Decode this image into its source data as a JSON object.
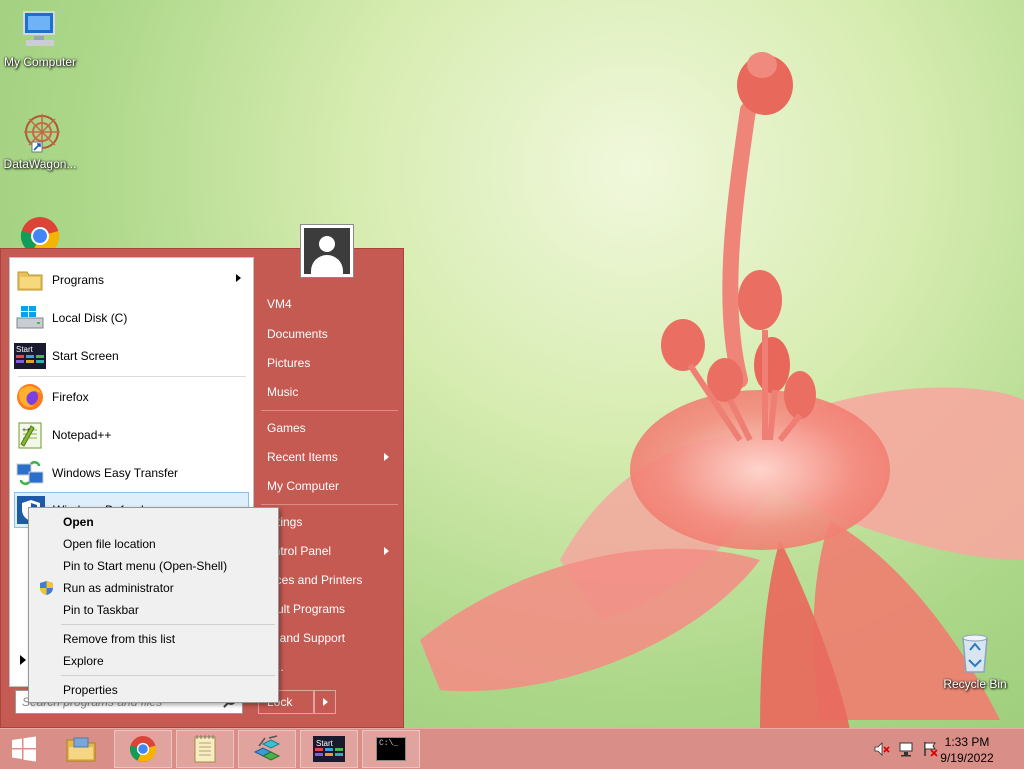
{
  "desktop": {
    "icons": [
      {
        "label": "My Computer",
        "icon": "computer-icon"
      },
      {
        "label": "DataWagon...",
        "icon": "datawagon-icon"
      },
      {
        "label": "",
        "icon": "chrome-icon"
      },
      {
        "label": "Recycle Bin",
        "icon": "recycle-bin-icon"
      }
    ]
  },
  "start_menu": {
    "programs": [
      {
        "label": "Programs",
        "icon": "folder-icon",
        "has_submenu": true
      },
      {
        "label": "Local Disk (C)",
        "icon": "drive-icon"
      },
      {
        "label": "Start Screen",
        "icon": "start-screen-icon"
      },
      {
        "label": "Firefox",
        "icon": "firefox-icon"
      },
      {
        "label": "Notepad++",
        "icon": "notepadpp-icon"
      },
      {
        "label": "Windows Easy Transfer",
        "icon": "easy-transfer-icon"
      },
      {
        "label": "Windows Defender",
        "icon": "defender-icon"
      }
    ],
    "search_placeholder": "Search programs and files",
    "right_items": [
      {
        "label": "VM4"
      },
      {
        "label": "Documents"
      },
      {
        "label": "Pictures"
      },
      {
        "label": "Music"
      },
      {
        "label": "Games"
      },
      {
        "label": "Recent Items",
        "has_submenu": true
      },
      {
        "label": "My Computer"
      },
      {
        "label": "ettings"
      },
      {
        "label": "ontrol Panel",
        "has_submenu": true
      },
      {
        "label": "vices and Printers"
      },
      {
        "label": "fault Programs"
      },
      {
        "label": "lp and Support"
      },
      {
        "label": "n..."
      }
    ],
    "shutdown_label": "Lock"
  },
  "context_menu": {
    "items": [
      {
        "label": "Open",
        "bold": true
      },
      {
        "label": "Open file location"
      },
      {
        "label": "Pin to Start menu (Open-Shell)"
      },
      {
        "label": "Run as administrator",
        "icon": "uac-shield-icon"
      },
      {
        "label": "Pin to Taskbar"
      },
      {
        "label": "Remove from this list"
      },
      {
        "label": "Explore"
      },
      {
        "label": "Properties"
      }
    ]
  },
  "taskbar": {
    "buttons": [
      {
        "name": "start-button",
        "icon": "windows-logo-icon"
      },
      {
        "name": "file-explorer",
        "icon": "folder-icon"
      },
      {
        "name": "chrome",
        "icon": "chrome-icon"
      },
      {
        "name": "notepad",
        "icon": "notepad-icon"
      },
      {
        "name": "registry",
        "icon": "registry-icon"
      },
      {
        "name": "start-screen",
        "icon": "start-screen-icon"
      },
      {
        "name": "cmd",
        "icon": "cmd-icon"
      }
    ],
    "start_tile_label": "Start",
    "cmd_label": "C:\\_",
    "clock_time": "1:33 PM",
    "clock_date": "9/19/2022"
  },
  "colors": {
    "start_menu_bg": "#c45a52",
    "taskbar_bg": "#d98f88",
    "highlight": "#dfeefb"
  }
}
